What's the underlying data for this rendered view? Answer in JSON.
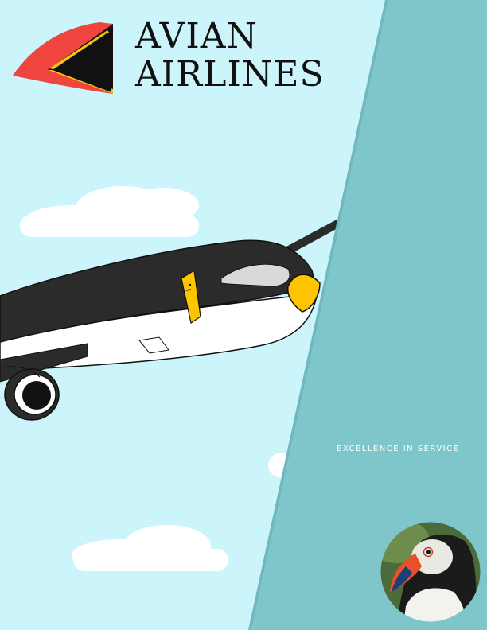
{
  "brand": {
    "name_line1": "AVIAN",
    "name_line2": "AIRLINES",
    "logo_icon": "bird-beak-logo-icon"
  },
  "tagline": "EXCELLENCE IN SERVICE",
  "colors": {
    "sky": "#ccf5fb",
    "panel": "#7fc6cb",
    "logo_red": "#f0453f",
    "logo_black": "#111111",
    "logo_yellow": "#f4c216",
    "plane_body": "#2b2b2b",
    "plane_nose": "#ffc400"
  },
  "images": {
    "airplane": "penguin-airplane-illustration",
    "puffin": "puffin-photo"
  }
}
